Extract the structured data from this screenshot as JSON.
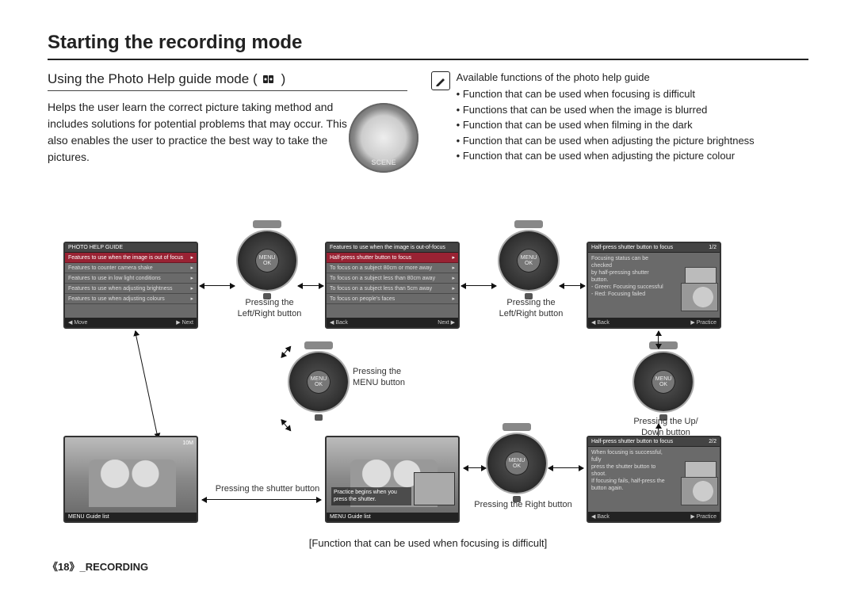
{
  "title": "Starting the recording mode",
  "subtitle": "Using the Photo Help guide mode (",
  "subtitle_close": ")",
  "intro": "Helps the user learn the correct picture taking method and includes solutions for potential problems that may occur. This also enables the user to practice the best way to take the pictures.",
  "note_title": "Available functions of the photo help guide",
  "bullets": [
    "Function that can be used when focusing is difficult",
    "Functions that can be used when the image is blurred",
    "Function that can be used when filming in the dark",
    "Function that can be used when adjusting the picture brightness",
    "Function that can be used when adjusting the picture colour"
  ],
  "lcd1": {
    "header": "PHOTO HELP GUIDE",
    "rows": [
      "Features to use when the image is out of focus",
      "Features to counter camera shake",
      "Features to use in low light conditions",
      "Features to use when adjusting brightness",
      "Features to use when adjusting colours"
    ],
    "footer_left": "◀  Move",
    "footer_right": "▶  Next"
  },
  "lcd2": {
    "header": "Features to use when the image is out-of-focus",
    "rows": [
      "Half-press shutter button to focus",
      "To focus on a subject 80cm or more away",
      "To focus on a subject less than 80cm away",
      "To focus on a subject less than 5cm away",
      "To focus on people's faces"
    ],
    "footer_left": "◀  Back",
    "footer_right": "Next  ▶"
  },
  "lcd3": {
    "header": "Half-press shutter button to focus",
    "page": "1/2",
    "body": [
      "Focusing status can be checked",
      "by half-pressing shutter button.",
      "- Green: Focusing successful",
      "- Red: Focusing failed"
    ],
    "footer_left": "◀  Back",
    "footer_right": "▶  Practice"
  },
  "lcd4": {
    "header": "Half-press shutter button to focus",
    "page": "2/2",
    "body": [
      "When focusing is successful, fully",
      "press the shutter button to shoot.",
      "If focusing fails, half-press the",
      "button again."
    ],
    "footer_left": "◀  Back",
    "footer_right": "▶  Practice"
  },
  "lcd5": {
    "overlay": "Practice begins when you press the shutter.",
    "bar": "MENU  Guide list"
  },
  "lcd6": {
    "bar": "MENU  Guide list",
    "topright": "10M"
  },
  "captions": {
    "lr1": "Pressing the\nLeft/Right  button",
    "lr2": "Pressing the\nLeft/Right  button",
    "menu": "Pressing the\nMENU button",
    "updown": "Pressing the Up/\nDown  button",
    "shutter": "Pressing the shutter button",
    "right": "Pressing the Right button"
  },
  "caption_center": "[Function that can be used when focusing is difficult]",
  "footer": {
    "pg": "《18》",
    "section": "_RECORDING"
  }
}
